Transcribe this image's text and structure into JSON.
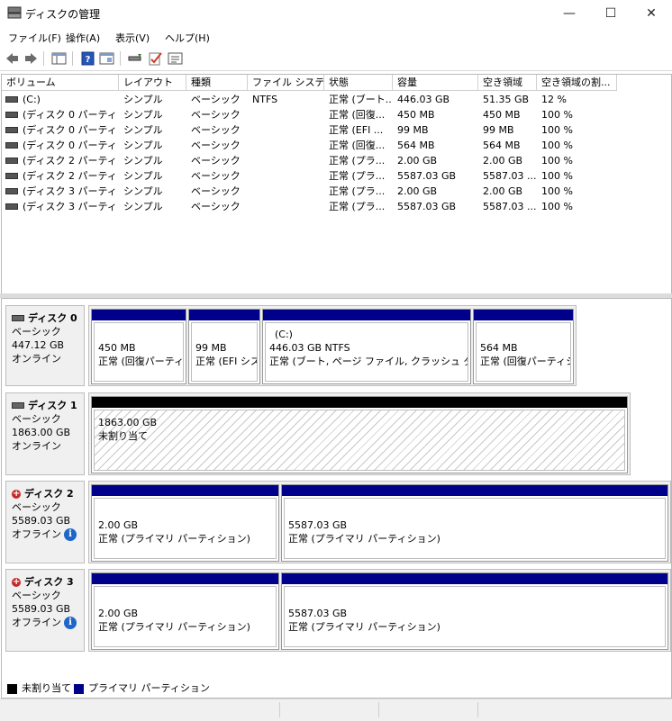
{
  "window": {
    "title": "ディスクの管理",
    "controls": [
      "—",
      "☐",
      "✕"
    ]
  },
  "menu": [
    "ファイル(F)",
    "操作(A)",
    "表示(V)",
    "ヘルプ(H)"
  ],
  "columns": [
    "ボリューム",
    "レイアウト",
    "種類",
    "ファイル システム",
    "状態",
    "容量",
    "空き領域",
    "空き領域の割..."
  ],
  "volumes": [
    [
      "(C:)",
      "シンプル",
      "ベーシック",
      "NTFS",
      "正常 (ブート...",
      "446.03 GB",
      "51.35 GB",
      "12 %"
    ],
    [
      "(ディスク 0 パーティシ...",
      "シンプル",
      "ベーシック",
      "",
      "正常 (回復...",
      "450 MB",
      "450 MB",
      "100 %"
    ],
    [
      "(ディスク 0 パーティシ...",
      "シンプル",
      "ベーシック",
      "",
      "正常 (EFI ...",
      "99 MB",
      "99 MB",
      "100 %"
    ],
    [
      "(ディスク 0 パーティシ...",
      "シンプル",
      "ベーシック",
      "",
      "正常 (回復...",
      "564 MB",
      "564 MB",
      "100 %"
    ],
    [
      "(ディスク 2 パーティシ...",
      "シンプル",
      "ベーシック",
      "",
      "正常 (プラ...",
      "2.00 GB",
      "2.00 GB",
      "100 %"
    ],
    [
      "(ディスク 2 パーティシ...",
      "シンプル",
      "ベーシック",
      "",
      "正常 (プラ...",
      "5587.03 GB",
      "5587.03 ...",
      "100 %"
    ],
    [
      "(ディスク 3 パーティシ...",
      "シンプル",
      "ベーシック",
      "",
      "正常 (プラ...",
      "2.00 GB",
      "2.00 GB",
      "100 %"
    ],
    [
      "(ディスク 3 パーティシ...",
      "シンプル",
      "ベーシック",
      "",
      "正常 (プラ...",
      "5587.03 GB",
      "5587.03 ...",
      "100 %"
    ]
  ],
  "disks": [
    {
      "name": "ディスク 0",
      "type": "ベーシック",
      "size": "447.12 GB",
      "status": "オンライン",
      "partitions": [
        {
          "label": "",
          "size": "450 MB",
          "state": "正常 (回復パーティション)"
        },
        {
          "label": "",
          "size": "99 MB",
          "state": "正常 (EFI システム パーティション)"
        },
        {
          "label": "(C:)",
          "size": "446.03 GB NTFS",
          "state": "正常 (ブート, ページ ファイル, クラッシュ ダンプ, ベーシック データ パーティション)"
        },
        {
          "label": "",
          "size": "564 MB",
          "state": "正常 (回復パーティション)"
        }
      ]
    },
    {
      "name": "ディスク 1",
      "type": "ベーシック",
      "size": "1863.00 GB",
      "status": "オンライン",
      "partitions": [
        {
          "label": "",
          "size": "1863.00 GB",
          "state": "未割り当て"
        }
      ]
    },
    {
      "name": "ディスク 2",
      "type": "ベーシック",
      "size": "5589.03 GB",
      "status": "オフライン",
      "partitions": [
        {
          "label": "",
          "size": "2.00 GB",
          "state": "正常 (プライマリ パーティション)"
        },
        {
          "label": "",
          "size": "5587.03 GB",
          "state": "正常 (プライマリ パーティション)"
        }
      ]
    },
    {
      "name": "ディスク 3",
      "type": "ベーシック",
      "size": "5589.03 GB",
      "status": "オフライン",
      "partitions": [
        {
          "label": "",
          "size": "2.00 GB",
          "state": "正常 (プライマリ パーティション)"
        },
        {
          "label": "",
          "size": "5587.03 GB",
          "state": "正常 (プライマリ パーティション)"
        }
      ]
    }
  ],
  "legend": [
    "未割り当て",
    "プライマリ パーティション"
  ],
  "colors": {
    "primary": "#00008b",
    "unallocated": "#000000",
    "offline": "#c62828",
    "info": "#1e66c8"
  },
  "info_glyph": "i",
  "toolbar_icons": [
    "back-arrow-icon",
    "forward-arrow-icon",
    "console-tree-icon",
    "help-icon",
    "properties-icon",
    "connect-icon",
    "check-icon",
    "settings-icon"
  ]
}
